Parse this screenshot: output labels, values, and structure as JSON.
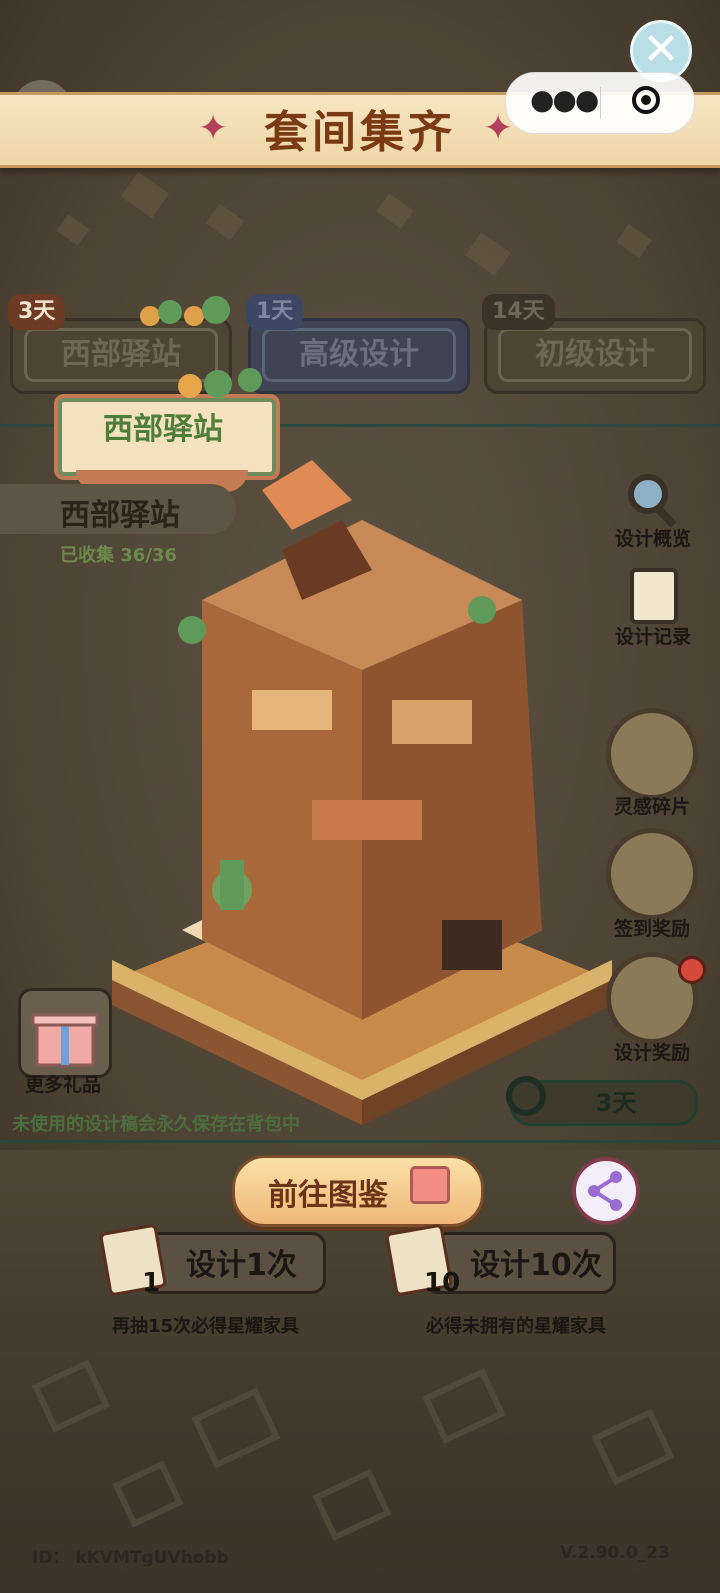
{
  "header": {
    "title": "套间集齐",
    "close_icon": "close-icon"
  },
  "capsule": {
    "more_icon": "more-dots-icon",
    "exit_icon": "exit-target-icon"
  },
  "tabs": [
    {
      "days": "3天",
      "label": "西部驿站",
      "active": true
    },
    {
      "days": "1天",
      "label": "高级设计",
      "active": false
    },
    {
      "days": "14天",
      "label": "初级设计",
      "active": false
    }
  ],
  "sign": {
    "label": "西部驿站"
  },
  "set": {
    "name": "西部驿站",
    "collected": "已收集 36/36"
  },
  "right_menu": [
    {
      "label": "设计概览",
      "icon": "magnifier-icon"
    },
    {
      "label": "设计记录",
      "icon": "clipboard-icon"
    },
    {
      "label": "灵感碎片",
      "icon": "map-fragment-icon"
    },
    {
      "label": "签到奖励",
      "icon": "calendar-icon"
    },
    {
      "label": "设计奖励",
      "icon": "cactus-icon",
      "badge": "red-dot"
    }
  ],
  "gifts": {
    "label": "更多礼品",
    "icon": "gift-box-icon"
  },
  "timer": {
    "text": "3天",
    "icon": "clock-icon"
  },
  "note": "未使用的设计稿会永久保存在背包中",
  "actions": {
    "go_catalog": "前往图鉴",
    "share_icon": "share-icon",
    "draw_once": {
      "label": "设计1次",
      "count": "1",
      "hint": "再抽15次必得星耀家具"
    },
    "draw_ten": {
      "label": "设计10次",
      "count": "10",
      "hint": "必得未拥有的星耀家具"
    }
  },
  "footer": {
    "id": "ID：  kKVMTgUVhobb",
    "version": "V.2.90.0_23"
  }
}
